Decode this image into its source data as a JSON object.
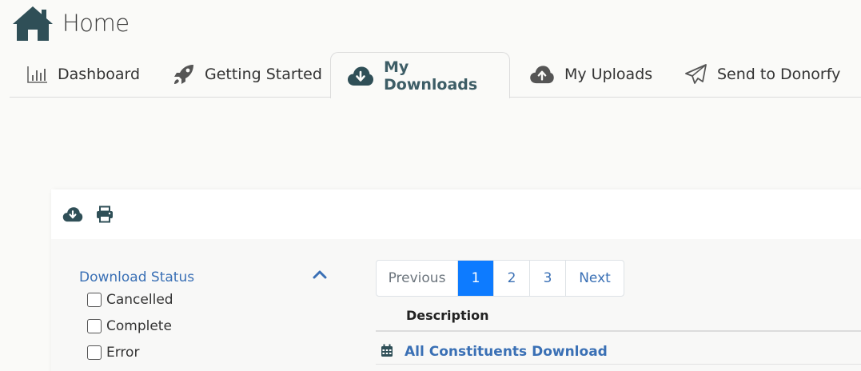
{
  "page": {
    "title": "Home",
    "icon": "home-icon"
  },
  "tabs": [
    {
      "label": "Dashboard",
      "icon": "bar-chart-icon",
      "active": false
    },
    {
      "label": "Getting Started",
      "icon": "rocket-icon",
      "active": false
    },
    {
      "label": "My Downloads",
      "icon": "cloud-download-icon",
      "active": true
    },
    {
      "label": "My Uploads",
      "icon": "cloud-upload-icon",
      "active": false
    },
    {
      "label": "Send to Donorfy",
      "icon": "paper-plane-icon",
      "active": false
    }
  ],
  "toolbar": {
    "download_icon": "cloud-download-icon",
    "print_icon": "print-icon"
  },
  "filter": {
    "title": "Download Status",
    "toggle_icon": "chevron-up-icon",
    "options": [
      {
        "label": "Cancelled",
        "checked": false
      },
      {
        "label": "Complete",
        "checked": false
      },
      {
        "label": "Error",
        "checked": false
      }
    ]
  },
  "pagination": {
    "previous_label": "Previous",
    "pages": [
      "1",
      "2",
      "3"
    ],
    "current": "1",
    "next_label": "Next"
  },
  "table": {
    "column_header": "Description",
    "rows": [
      {
        "icon": "calendar-icon",
        "description": "All Constituents Download"
      }
    ]
  },
  "colors": {
    "accent_blue": "#3a70b5",
    "active_page": "#0d7bff",
    "active_tab_text": "#3d5d66",
    "icon_dark": "#2f4f57"
  }
}
